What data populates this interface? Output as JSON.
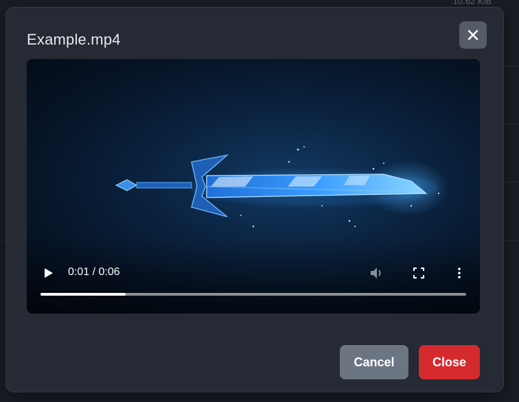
{
  "background": {
    "edge_text": "10.62 KiB"
  },
  "modal": {
    "title": "Example.mp4",
    "close_icon": "close-icon"
  },
  "player": {
    "current_time": "0:01",
    "duration": "0:06",
    "time_display": "0:01 / 0:06",
    "progress_fraction": 0.2,
    "icons": {
      "play": "play-icon",
      "volume": "volume-icon",
      "fullscreen": "fullscreen-icon",
      "more": "more-options-icon"
    }
  },
  "footer": {
    "cancel_label": "Cancel",
    "close_label": "Close"
  },
  "colors": {
    "modal_bg": "#252a34",
    "cancel_bg": "#6c7683",
    "close_bg": "#d42a2e",
    "accent_glow": "#3aa8ff"
  }
}
